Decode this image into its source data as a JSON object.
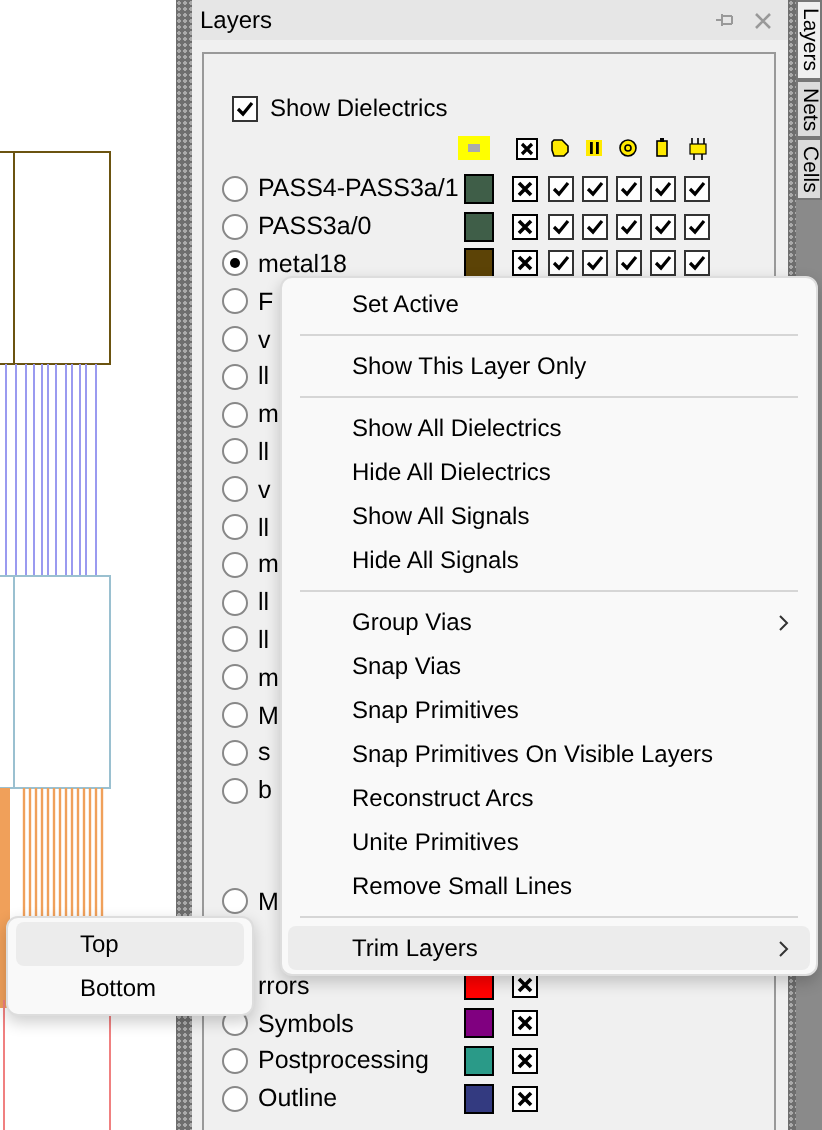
{
  "panel": {
    "title": "Layers",
    "side_tabs": [
      {
        "label": "Layers",
        "selected": true
      },
      {
        "label": "Nets",
        "selected": false
      },
      {
        "label": "Cells",
        "selected": false
      }
    ]
  },
  "show_dielectrics": {
    "label": "Show Dielectrics",
    "checked": true
  },
  "layer_groups": [
    {
      "rows": [
        {
          "name": "PASS4-PASS3a/1",
          "selected": false,
          "color": "#3f5e48",
          "visible": true,
          "checks": [
            true,
            true,
            true,
            true,
            true
          ]
        },
        {
          "name": "PASS3a/0",
          "selected": false,
          "color": "#3f5e48",
          "visible": true,
          "checks": [
            true,
            true,
            true,
            true,
            true
          ]
        },
        {
          "name": "metal18",
          "selected": true,
          "color": "#5c4306",
          "visible": true,
          "checks": [
            true,
            true,
            true,
            true,
            true
          ]
        },
        {
          "name": "F",
          "selected": false
        },
        {
          "name": "v",
          "selected": false
        },
        {
          "name": "ll",
          "selected": false
        },
        {
          "name": "m",
          "selected": false
        },
        {
          "name": "ll",
          "selected": false
        },
        {
          "name": "v",
          "selected": false
        },
        {
          "name": "ll",
          "selected": false
        },
        {
          "name": "m",
          "selected": false
        },
        {
          "name": "ll",
          "selected": false
        },
        {
          "name": "ll",
          "selected": false
        },
        {
          "name": "m",
          "selected": false
        },
        {
          "name": "M",
          "selected": false
        },
        {
          "name": "s",
          "selected": false
        },
        {
          "name": "b",
          "selected": false
        }
      ]
    },
    {
      "rows": [
        {
          "name": "M",
          "selected": false
        }
      ]
    },
    {
      "rows": [
        {
          "name": "rrors",
          "color": "#ff0000",
          "visible": true
        },
        {
          "name": "Symbols",
          "selected": false,
          "color": "#800080",
          "visible": true
        },
        {
          "name": "Postprocessing",
          "selected": false,
          "color": "#2a9a88",
          "visible": true
        },
        {
          "name": "Outline",
          "selected": false,
          "color": "#333a80",
          "visible": true
        }
      ]
    }
  ],
  "context_menu": [
    {
      "kind": "item",
      "label": "Set Active",
      "submenu": false,
      "selected": false
    },
    {
      "kind": "separator"
    },
    {
      "kind": "item",
      "label": "Show This Layer Only",
      "submenu": false,
      "selected": false
    },
    {
      "kind": "separator"
    },
    {
      "kind": "item",
      "label": "Show All Dielectrics",
      "submenu": false,
      "selected": false
    },
    {
      "kind": "item",
      "label": "Hide All Dielectrics",
      "submenu": false,
      "selected": false
    },
    {
      "kind": "item",
      "label": "Show All Signals",
      "submenu": false,
      "selected": false
    },
    {
      "kind": "item",
      "label": "Hide All Signals",
      "submenu": false,
      "selected": false
    },
    {
      "kind": "separator"
    },
    {
      "kind": "item",
      "label": "Group Vias",
      "submenu": true,
      "selected": false
    },
    {
      "kind": "item",
      "label": "Snap Vias",
      "submenu": false,
      "selected": false
    },
    {
      "kind": "item",
      "label": "Snap Primitives",
      "submenu": false,
      "selected": false
    },
    {
      "kind": "item",
      "label": "Snap Primitives On Visible Layers",
      "submenu": false,
      "selected": false
    },
    {
      "kind": "item",
      "label": "Reconstruct Arcs",
      "submenu": false,
      "selected": false
    },
    {
      "kind": "item",
      "label": "Unite Primitives",
      "submenu": false,
      "selected": false
    },
    {
      "kind": "item",
      "label": "Remove Small Lines",
      "submenu": false,
      "selected": false
    },
    {
      "kind": "separator"
    },
    {
      "kind": "item",
      "label": "Trim Layers",
      "submenu": true,
      "selected": true
    }
  ],
  "submenu": [
    {
      "label": "Top",
      "selected": true
    },
    {
      "label": "Bottom",
      "selected": false
    }
  ]
}
